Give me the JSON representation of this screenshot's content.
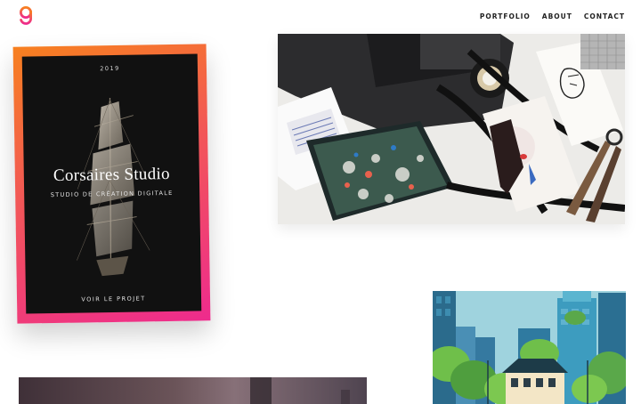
{
  "header": {
    "logo_icon": "letter-g-logo-icon",
    "nav": [
      {
        "label": "PORTFOLIO"
      },
      {
        "label": "ABOUT"
      },
      {
        "label": "CONTACT"
      }
    ]
  },
  "project_card": {
    "year": "2019",
    "title": "Corsaires Studio",
    "subtitle": "STUDIO DE CRÉATION DIGITALE",
    "cta": "VOIR LE PROJET",
    "gradient": [
      "#f7801f",
      "#ee2b8d"
    ]
  },
  "colors": {
    "brand_pink": "#ee2b6b",
    "brand_orange": "#f7801f",
    "card_bg": "#111111",
    "nav_text": "#222222"
  }
}
